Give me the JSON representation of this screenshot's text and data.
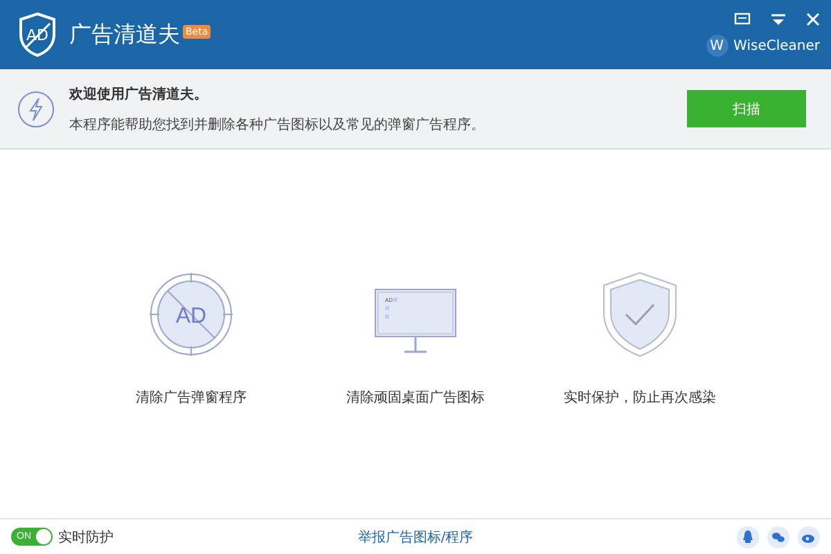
{
  "header": {
    "logo_text": "AD",
    "title": "广告清道夫",
    "badge": "Beta",
    "brand_initial": "W",
    "brand": "WiseCleaner"
  },
  "banner": {
    "heading": "欢迎使用广告清道夫。",
    "description": "本程序能帮助您找到并删除各种广告图标以及常见的弹窗广告程序。",
    "button": "扫描"
  },
  "features": [
    {
      "kind": "popup",
      "icon_text": "AD",
      "label": "清除广告弹窗程序"
    },
    {
      "kind": "desktop",
      "icon_text": "AD",
      "label": "清除顽固桌面广告图标"
    },
    {
      "kind": "shield",
      "label": "实时保护，防止再次感染"
    }
  ],
  "footer": {
    "toggle": {
      "text": "ON",
      "on": true
    },
    "toggle_label": "实时防护",
    "link": "举报广告图标/程序"
  }
}
